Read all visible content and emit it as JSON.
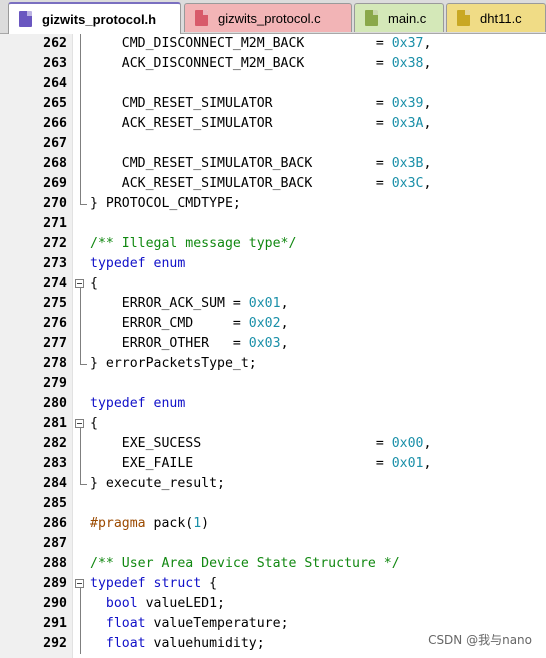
{
  "tabs": [
    {
      "label": "gizwits_protocol.h",
      "active": true,
      "color": "#6a57c0"
    },
    {
      "label": "gizwits_protocol.c",
      "active": false,
      "color": "#f2b4b6"
    },
    {
      "label": "main.c",
      "active": false,
      "color": "#d4e8b8"
    },
    {
      "label": "dht11.c",
      "active": false,
      "color": "#f0dc86"
    }
  ],
  "lines": [
    {
      "n": "262",
      "fold": "line",
      "t": [
        [
          "    CMD_DISCONNECT_M2M_BACK         = ",
          ""
        ],
        [
          "0x37",
          "num"
        ],
        [
          ",",
          ""
        ]
      ]
    },
    {
      "n": "263",
      "fold": "line",
      "t": [
        [
          "    ACK_DISCONNECT_M2M_BACK         = ",
          ""
        ],
        [
          "0x38",
          "num"
        ],
        [
          ",",
          ""
        ]
      ]
    },
    {
      "n": "264",
      "fold": "line",
      "t": []
    },
    {
      "n": "265",
      "fold": "line",
      "t": [
        [
          "    CMD_RESET_SIMULATOR             = ",
          ""
        ],
        [
          "0x39",
          "num"
        ],
        [
          ",",
          ""
        ]
      ]
    },
    {
      "n": "266",
      "fold": "line",
      "t": [
        [
          "    ACK_RESET_SIMULATOR             = ",
          ""
        ],
        [
          "0x3A",
          "num"
        ],
        [
          ",",
          ""
        ]
      ]
    },
    {
      "n": "267",
      "fold": "line",
      "t": []
    },
    {
      "n": "268",
      "fold": "line",
      "t": [
        [
          "    CMD_RESET_SIMULATOR_BACK        = ",
          ""
        ],
        [
          "0x3B",
          "num"
        ],
        [
          ",",
          ""
        ]
      ]
    },
    {
      "n": "269",
      "fold": "line",
      "t": [
        [
          "    ACK_RESET_SIMULATOR_BACK        = ",
          ""
        ],
        [
          "0x3C",
          "num"
        ],
        [
          ",",
          ""
        ]
      ]
    },
    {
      "n": "270",
      "fold": "end",
      "t": [
        [
          "} PROTOCOL_CMDTYPE;",
          ""
        ]
      ]
    },
    {
      "n": "271",
      "fold": "none",
      "t": []
    },
    {
      "n": "272",
      "fold": "none",
      "t": [
        [
          "/** Illegal message type*/",
          "cm"
        ]
      ]
    },
    {
      "n": "273",
      "fold": "none",
      "t": [
        [
          "typedef",
          "kw"
        ],
        [
          " ",
          ""
        ],
        [
          "enum",
          "kw"
        ]
      ]
    },
    {
      "n": "274",
      "fold": "box",
      "t": [
        [
          "{",
          ""
        ]
      ]
    },
    {
      "n": "275",
      "fold": "line",
      "t": [
        [
          "    ERROR_ACK_SUM = ",
          ""
        ],
        [
          "0x01",
          "num"
        ],
        [
          ",",
          ""
        ]
      ]
    },
    {
      "n": "276",
      "fold": "line",
      "t": [
        [
          "    ERROR_CMD     = ",
          ""
        ],
        [
          "0x02",
          "num"
        ],
        [
          ",",
          ""
        ]
      ]
    },
    {
      "n": "277",
      "fold": "line",
      "t": [
        [
          "    ERROR_OTHER   = ",
          ""
        ],
        [
          "0x03",
          "num"
        ],
        [
          ",",
          ""
        ]
      ]
    },
    {
      "n": "278",
      "fold": "end",
      "t": [
        [
          "} errorPacketsType_t;",
          ""
        ]
      ]
    },
    {
      "n": "279",
      "fold": "none",
      "t": []
    },
    {
      "n": "280",
      "fold": "none",
      "t": [
        [
          "typedef",
          "kw"
        ],
        [
          " ",
          ""
        ],
        [
          "enum",
          "kw"
        ]
      ]
    },
    {
      "n": "281",
      "fold": "box",
      "t": [
        [
          "{",
          ""
        ]
      ]
    },
    {
      "n": "282",
      "fold": "line",
      "t": [
        [
          "    EXE_SUCESS                      = ",
          ""
        ],
        [
          "0x00",
          "num"
        ],
        [
          ",",
          ""
        ]
      ]
    },
    {
      "n": "283",
      "fold": "line",
      "t": [
        [
          "    EXE_FAILE                       = ",
          ""
        ],
        [
          "0x01",
          "num"
        ],
        [
          ",",
          ""
        ]
      ]
    },
    {
      "n": "284",
      "fold": "end",
      "t": [
        [
          "} execute_result;",
          ""
        ]
      ]
    },
    {
      "n": "285",
      "fold": "none",
      "t": []
    },
    {
      "n": "286",
      "fold": "none",
      "t": [
        [
          "#pragma",
          "pp"
        ],
        [
          " pack(",
          ""
        ],
        [
          "1",
          "num"
        ],
        [
          ")",
          ""
        ]
      ]
    },
    {
      "n": "287",
      "fold": "none",
      "t": []
    },
    {
      "n": "288",
      "fold": "none",
      "t": [
        [
          "/** User Area Device State Structure */",
          "cm"
        ]
      ]
    },
    {
      "n": "289",
      "fold": "box",
      "t": [
        [
          "typedef",
          "kw"
        ],
        [
          " ",
          ""
        ],
        [
          "struct",
          "kw"
        ],
        [
          " {",
          ""
        ]
      ]
    },
    {
      "n": "290",
      "fold": "line",
      "t": [
        [
          "  ",
          ""
        ],
        [
          "bool",
          "kw"
        ],
        [
          " valueLED1;",
          ""
        ]
      ]
    },
    {
      "n": "291",
      "fold": "line",
      "t": [
        [
          "  ",
          ""
        ],
        [
          "float",
          "kw"
        ],
        [
          " valueTemperature;",
          ""
        ]
      ]
    },
    {
      "n": "292",
      "fold": "line",
      "t": [
        [
          "  ",
          ""
        ],
        [
          "float",
          "kw"
        ],
        [
          " valuehumidity;",
          ""
        ]
      ]
    }
  ],
  "watermark": "CSDN @我与nano",
  "colors": {
    "keyword": "#1010c8",
    "number": "#1a8fa8",
    "comment": "#118811",
    "preprocessor": "#9b4a00"
  }
}
